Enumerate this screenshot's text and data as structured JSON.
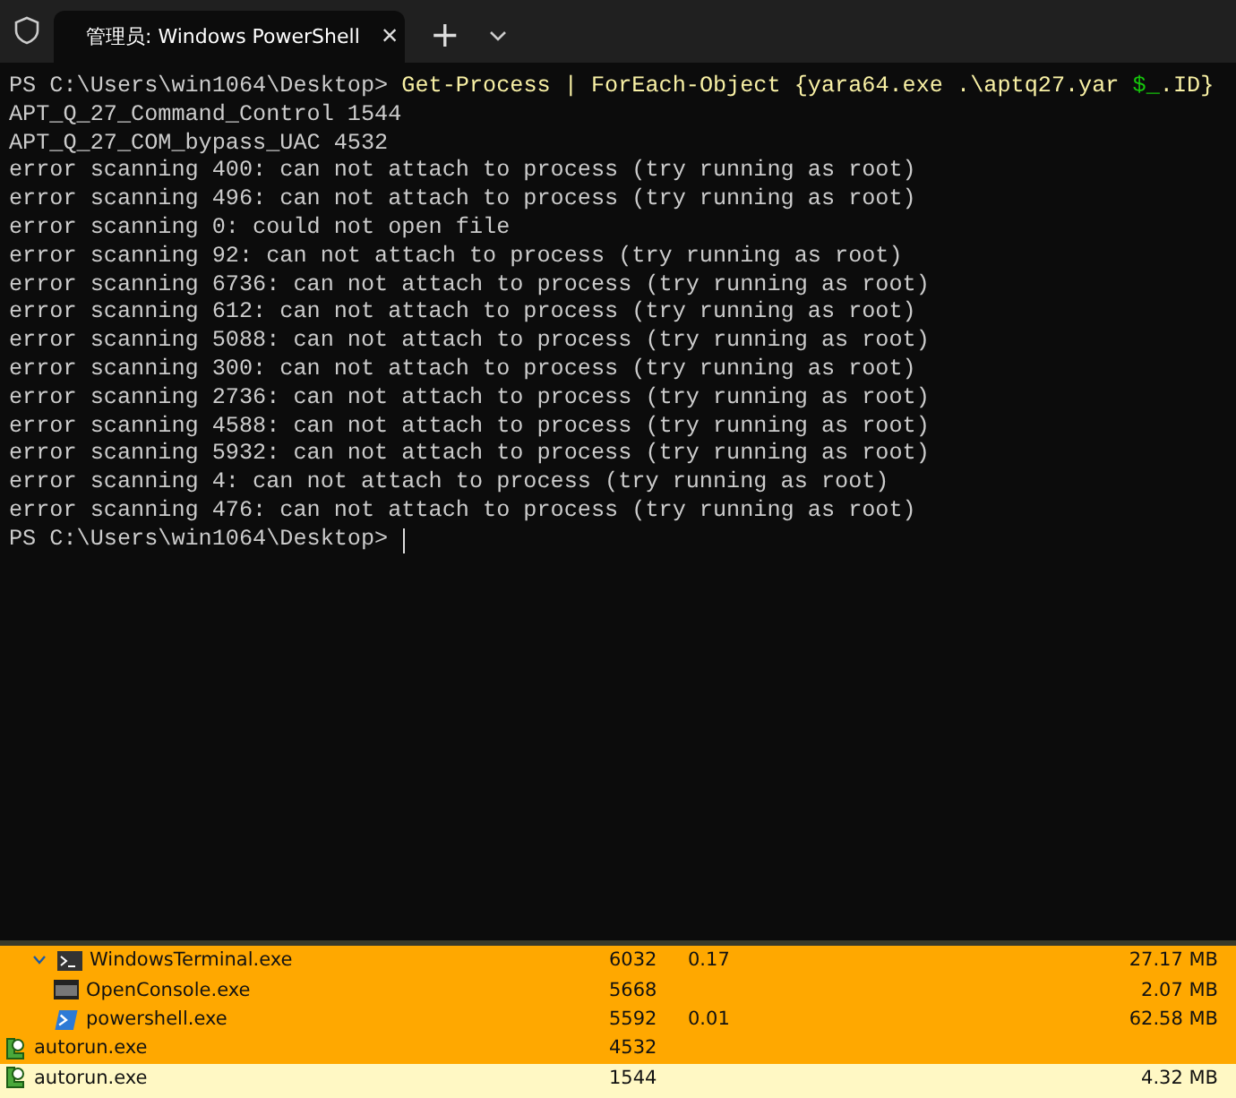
{
  "tabs": [
    {
      "title": "管理员: Windows PowerShell",
      "close": "×",
      "selected": true
    }
  ],
  "new_tab": "+",
  "terminal": {
    "command_line": [
      {
        "kind": "prompt",
        "text": "PS C:\\Users\\win1064\\Desktop>"
      },
      {
        "kind": "command",
        "text": " Get-Process | ForEach-Object {yara64.exe .\\aptq27.yar"
      },
      {
        "kind": "variable",
        "text": " $_"
      },
      {
        "kind": "command",
        "text": ".ID}"
      }
    ],
    "output": [
      "APT_Q_27_Command_Control 1544",
      "APT_Q_27_COM_bypass_UAC 4532",
      "error scanning 400: can not attach to process (try running as root)",
      "error scanning 496: can not attach to process (try running as root)",
      "error scanning 0: could not open file",
      "error scanning 92: can not attach to process (try running as root)",
      "error scanning 6736: can not attach to process (try running as root)",
      "error scanning 612: can not attach to process (try running as root)",
      "error scanning 5088: can not attach to process (try running as root)",
      "error scanning 300: can not attach to process (try running as root)",
      "error scanning 2736: can not attach to process (try running as root)",
      "error scanning 4588: can not attach to process (try running as root)",
      "error scanning 5932: can not attach to process (try running as root)",
      "error scanning 4: can not attach to process (try running as root)",
      "error scanning 476: can not attach to process (try running as root)"
    ],
    "prompt": "PS C:\\Users\\win1064\\Desktop>"
  },
  "processes": [
    {
      "name": "WindowsTerminal.exe",
      "kind": "terminal",
      "pid": "6032",
      "cpu": "0.17",
      "memory": "27.17 MB",
      "color": "#ffa800",
      "expanded": true,
      "children": [
        {
          "name": "OpenConsole.exe",
          "kind": "console",
          "pid": "5668",
          "memory": "2.07 MB",
          "color": "#ffa800"
        },
        {
          "name": "powershell.exe",
          "kind": "powershell",
          "pid": "5592",
          "cpu": "0.01",
          "memory": "62.58 MB",
          "color": "#ffa800"
        }
      ]
    },
    {
      "name": "autorun.exe",
      "kind": "autorun",
      "pid": "4532",
      "color": "#ffa800"
    },
    {
      "name": "autorun.exe",
      "kind": "autorun",
      "pid": "1544",
      "memory": "4.32 MB",
      "color": "#fff8c4"
    }
  ]
}
